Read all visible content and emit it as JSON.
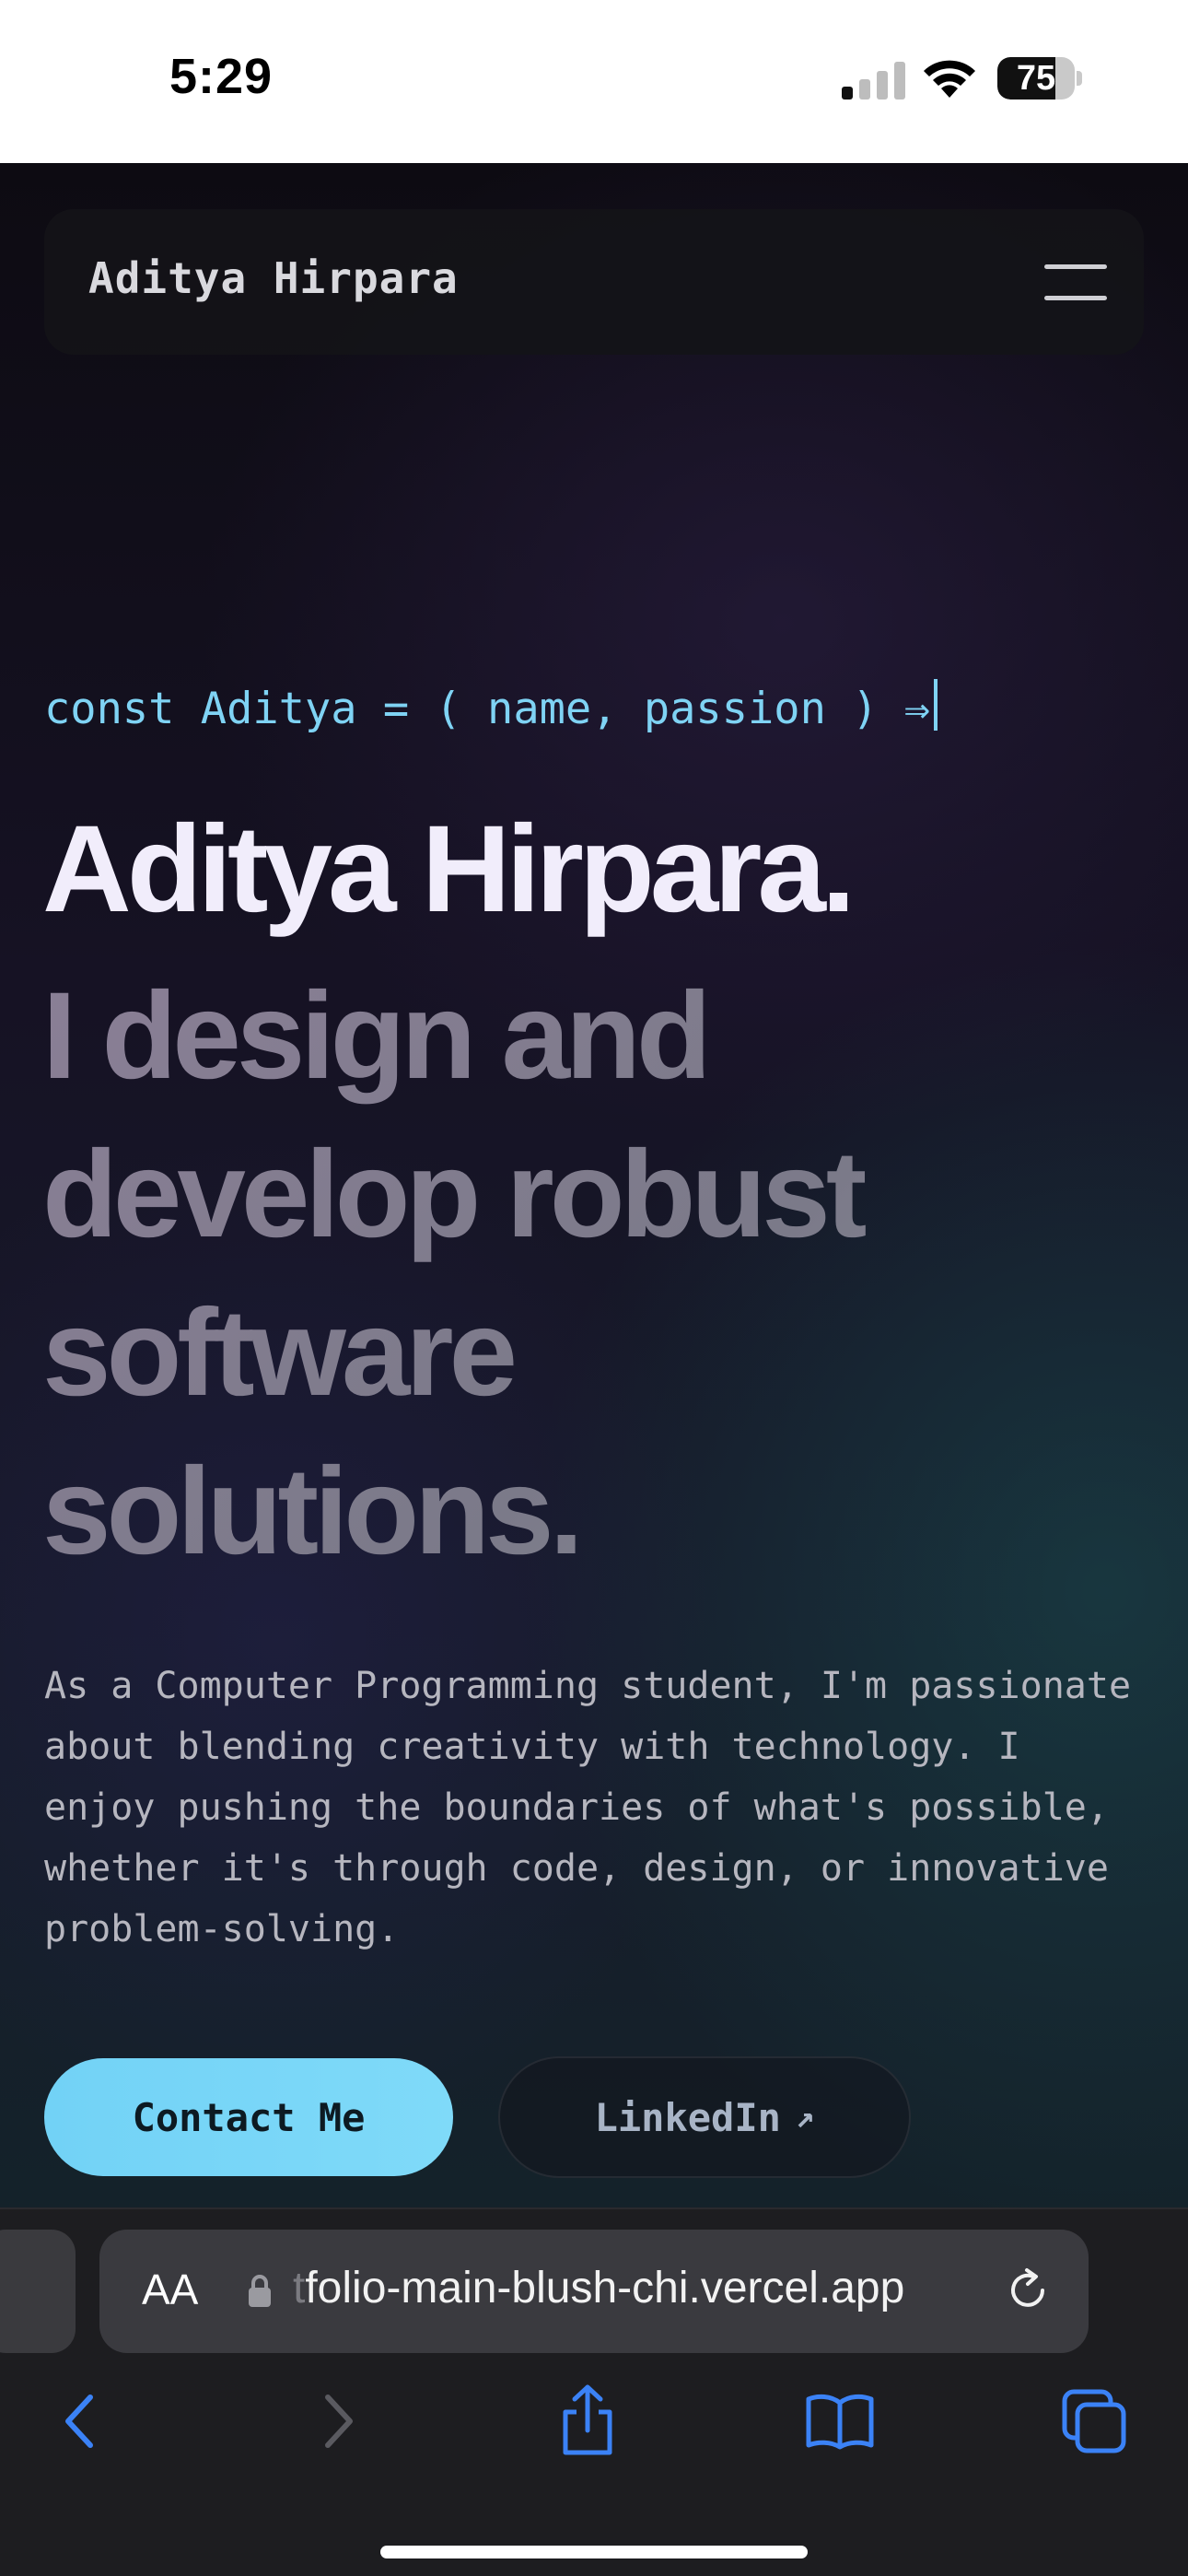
{
  "status_bar": {
    "time": "5:29",
    "battery_level": "75",
    "battery_fraction": 0.75,
    "signal_icon": "signal-bars-icon",
    "wifi_icon": "wifi-icon"
  },
  "navbar": {
    "brand": "Aditya Hirpara",
    "menu_icon": "hamburger-menu-icon"
  },
  "hero": {
    "code_line": "const Aditya = ( name, passion ) ⇒",
    "name": "Aditya Hirpara.",
    "tagline": "I design and\ndevelop robust\nsoftware\nsolutions.",
    "intro": "As a Computer Programming student, I'm passionate about blending creativity with technology. I enjoy pushing the boundaries of what's possible, whether it's through code, design, or innovative problem-solving."
  },
  "buttons": {
    "contact_label": "Contact Me",
    "linkedin_label": "LinkedIn",
    "linkedin_arrow": "↗"
  },
  "browser": {
    "aa_label": "AA",
    "url_faded_prefix": "t",
    "url": "folio-main-blush-chi.vercel.app"
  },
  "colors": {
    "accent": "#7fd3f4",
    "ios_blue": "#3b82f6",
    "ios_disabled": "#5a5a60"
  }
}
